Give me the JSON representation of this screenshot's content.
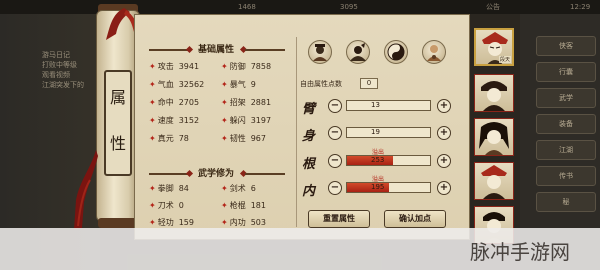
{
  "top_bar": {
    "item_count": "1468",
    "currency_mid": "3095",
    "right_text": "公告",
    "clock": "12:29"
  },
  "left_log": [
    "游马日记",
    "打败中等级",
    "观看视频",
    "江湖突发下的"
  ],
  "right_menu": [
    "侠客",
    "行囊",
    "武学",
    "装备",
    "江湖",
    "传书",
    "秘"
  ],
  "scroll_title": [
    "属",
    "性"
  ],
  "basic_stats": {
    "title": "基础属性",
    "items": [
      {
        "label": "攻击",
        "value": "3941"
      },
      {
        "label": "防御",
        "value": "7858"
      },
      {
        "label": "气血",
        "value": "32562"
      },
      {
        "label": "暴气",
        "value": "9"
      },
      {
        "label": "命中",
        "value": "2705"
      },
      {
        "label": "招架",
        "value": "2881"
      },
      {
        "label": "速度",
        "value": "3152"
      },
      {
        "label": "躲闪",
        "value": "3197"
      },
      {
        "label": "真元",
        "value": "78"
      },
      {
        "label": "韧性",
        "value": "967"
      }
    ]
  },
  "martial_stats": {
    "title": "武学修为",
    "items": [
      {
        "label": "拳脚",
        "value": "84"
      },
      {
        "label": "剑术",
        "value": "6"
      },
      {
        "label": "刀术",
        "value": "0"
      },
      {
        "label": "枪棍",
        "value": "181"
      },
      {
        "label": "轻功",
        "value": "159"
      },
      {
        "label": "内功",
        "value": "503"
      }
    ]
  },
  "free_points": {
    "label": "自由属性点数",
    "value": "0"
  },
  "attributes": [
    {
      "char": "臂",
      "value": "13",
      "fill": 0.0,
      "overflow": ""
    },
    {
      "char": "身",
      "value": "19",
      "fill": 0.0,
      "overflow": ""
    },
    {
      "char": "根",
      "value": "253",
      "fill": 0.55,
      "overflow": "溢出"
    },
    {
      "char": "内",
      "value": "195",
      "fill": 0.5,
      "overflow": "溢出"
    }
  ],
  "buttons": {
    "reset": "重置属性",
    "confirm": "确认加点"
  },
  "cards": [
    {
      "name": "段天"
    },
    {
      "name": ""
    },
    {
      "name": ""
    },
    {
      "name": ""
    },
    {
      "name": ""
    }
  ],
  "watermark": "脉冲手游网",
  "colors": {
    "accent_red": "#b32418",
    "bar_fill": "#c8361e",
    "paper": "#e4d9bd"
  }
}
